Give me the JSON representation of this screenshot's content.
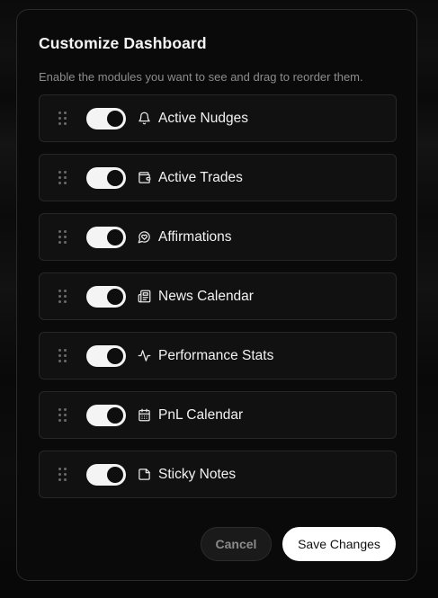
{
  "dialog": {
    "title": "Customize Dashboard",
    "subtitle": "Enable the modules you want to see and drag to reorder them."
  },
  "modules": [
    {
      "label": "Active Nudges",
      "enabled": true,
      "icon": "bell-icon"
    },
    {
      "label": "Active Trades",
      "enabled": true,
      "icon": "wallet-icon"
    },
    {
      "label": "Affirmations",
      "enabled": true,
      "icon": "heart-chat-icon"
    },
    {
      "label": "News Calendar",
      "enabled": true,
      "icon": "newspaper-icon"
    },
    {
      "label": "Performance Stats",
      "enabled": true,
      "icon": "activity-icon"
    },
    {
      "label": "PnL Calendar",
      "enabled": true,
      "icon": "calendar-icon"
    },
    {
      "label": "Sticky Notes",
      "enabled": true,
      "icon": "sticky-note-icon"
    }
  ],
  "footer": {
    "cancel_label": "Cancel",
    "save_label": "Save Changes"
  },
  "colors": {
    "background": "#060606",
    "dialog_bg": "#0a0a0a",
    "card_bg": "#111111",
    "toggle_on": "#f4f4f4",
    "save_bg": "#ffffff",
    "muted_text": "#8c8c8c"
  }
}
